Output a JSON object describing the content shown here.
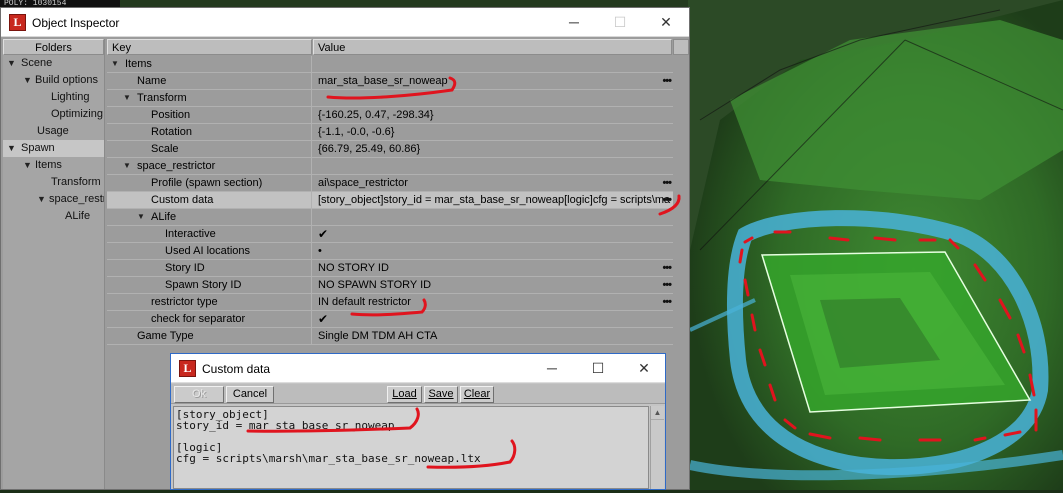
{
  "top_strip": {
    "text": "POLY:            1030154"
  },
  "inspector": {
    "title": "Object Inspector",
    "titlebar_buttons": {
      "minimize": "─",
      "maximize": "☐",
      "close": "✕"
    },
    "folders_header": "Folders",
    "tree": [
      {
        "label": "Scene",
        "expand": "▼"
      },
      {
        "label": "Build options",
        "expand": "▼"
      },
      {
        "label": "Lighting",
        "expand": ""
      },
      {
        "label": "Optimizing",
        "expand": ""
      },
      {
        "label": "Usage",
        "expand": ""
      },
      {
        "label": "Spawn",
        "expand": "▼"
      },
      {
        "label": "Items",
        "expand": "▼"
      },
      {
        "label": "Transform",
        "expand": ""
      },
      {
        "label": "space_restr",
        "expand": "▼"
      },
      {
        "label": "ALife",
        "expand": ""
      }
    ],
    "columns": {
      "key": "Key",
      "value": "Value"
    },
    "rows": [
      {
        "key": "Items",
        "value": "",
        "expand": "▼",
        "ellipsis": ""
      },
      {
        "key": "Name",
        "value": "mar_sta_base_sr_noweap",
        "expand": "",
        "ellipsis": "•••"
      },
      {
        "key": "Transform",
        "value": "",
        "expand": "▼",
        "ellipsis": ""
      },
      {
        "key": "Position",
        "value": "{-160.25, 0.47, -298.34}",
        "expand": "",
        "ellipsis": ""
      },
      {
        "key": "Rotation",
        "value": "{-1.1, -0.0, -0.6}",
        "expand": "",
        "ellipsis": ""
      },
      {
        "key": "Scale",
        "value": "{66.79, 25.49, 60.86}",
        "expand": "",
        "ellipsis": ""
      },
      {
        "key": "space_restrictor",
        "value": "",
        "expand": "▼",
        "ellipsis": ""
      },
      {
        "key": "Profile (spawn section)",
        "value": "ai\\space_restrictor",
        "expand": "",
        "ellipsis": "•••"
      },
      {
        "key": "Custom data",
        "value": "[story_object]story_id = mar_sta_base_sr_noweap[logic]cfg = scripts\\ma",
        "expand": "",
        "ellipsis": "•••"
      },
      {
        "key": "ALife",
        "value": "",
        "expand": "▼",
        "ellipsis": ""
      },
      {
        "key": "Interactive",
        "value": "✔",
        "expand": "",
        "ellipsis": ""
      },
      {
        "key": "Used AI locations",
        "value": "•",
        "expand": "",
        "ellipsis": ""
      },
      {
        "key": "Story ID",
        "value": "NO STORY ID",
        "expand": "",
        "ellipsis": "•••"
      },
      {
        "key": "Spawn Story ID",
        "value": "NO SPAWN STORY ID",
        "expand": "",
        "ellipsis": "•••"
      },
      {
        "key": "restrictor type",
        "value": "IN default restrictor",
        "expand": "",
        "ellipsis": "•••"
      },
      {
        "key": "check for separator",
        "value": "✔",
        "expand": "",
        "ellipsis": ""
      },
      {
        "key": "Game Type",
        "value": "Single DM TDM AH CTA",
        "expand": "",
        "ellipsis": ""
      }
    ]
  },
  "custom_data_dialog": {
    "title": "Custom data",
    "titlebar_buttons": {
      "minimize": "─",
      "maximize": "☐",
      "close": "✕"
    },
    "buttons": {
      "ok": "Ok",
      "cancel": "Cancel",
      "load": "Load",
      "save": "Save",
      "clear": "Clear"
    },
    "text": "[story_object]\nstory_id = mar_sta_base_sr_noweap\n\n[logic]\ncfg = scripts\\marsh\\mar_sta_base_sr_noweap.ltx"
  },
  "colors": {
    "annotation_red": "#e0141e",
    "terrain_green": "#3e7a2c",
    "water_blue": "#49b3d9"
  }
}
